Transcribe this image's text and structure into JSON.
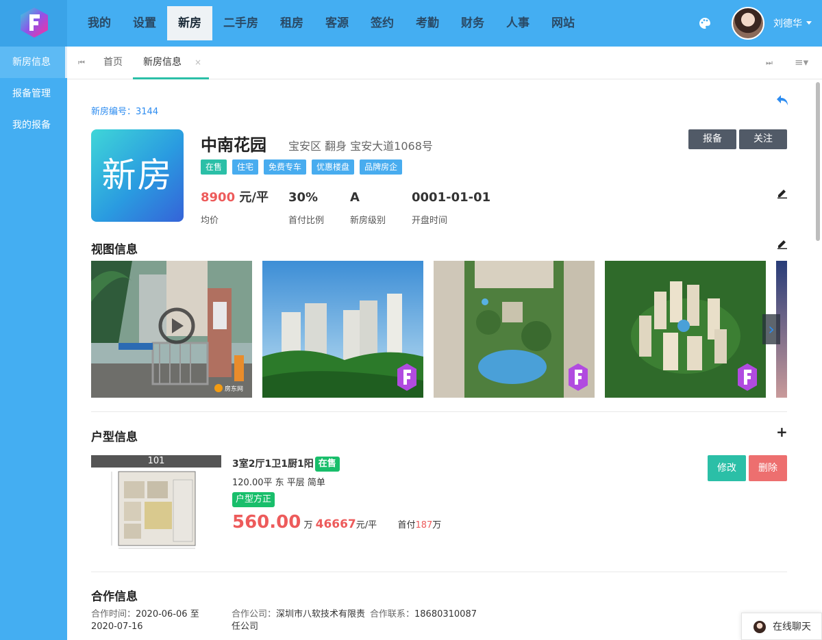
{
  "nav": {
    "items": [
      "我的",
      "设置",
      "新房",
      "二手房",
      "租房",
      "客源",
      "签约",
      "考勤",
      "财务",
      "人事",
      "网站"
    ],
    "active": "新房"
  },
  "user": {
    "name": "刘德华"
  },
  "sidebar": {
    "items": [
      "新房信息",
      "报备管理",
      "我的报备"
    ]
  },
  "tabs": {
    "home": "首页",
    "current": "新房信息",
    "close": "×"
  },
  "house": {
    "number_label": "新房编号：3144",
    "cover_text": "新房",
    "name": "中南花园",
    "address": "宝安区 翻身 宝安大道1068号",
    "tags": [
      "在售",
      "住宅",
      "免费专车",
      "优惠楼盘",
      "品牌房企"
    ],
    "price_value": "8900",
    "price_unit": " 元/平",
    "price_label": "均价",
    "down_ratio": "30%",
    "down_ratio_label": "首付比例",
    "level": "A",
    "level_label": "新房级别",
    "open_date": "0001-01-01",
    "open_date_label": "开盘时间"
  },
  "actions": {
    "report": "报备",
    "follow": "关注"
  },
  "sections": {
    "view": "视图信息",
    "unit": "户型信息",
    "coop": "合作信息"
  },
  "unit": {
    "plan_label": "101",
    "spec": "3室2厅1卫1厨1阳",
    "status": "在售",
    "sub": "120.00平 东 平层 简单",
    "tag": "户型方正",
    "total_price": "560.00",
    "total_unit": " 万 ",
    "unit_price": "46667",
    "unit_price_suffix": "元/平",
    "down_label": "首付",
    "down_value": "187",
    "down_unit": "万",
    "edit": "修改",
    "delete": "删除"
  },
  "coop": {
    "time_label": "合作时间：",
    "time_value": "2020-06-06 至 2020-07-16",
    "company_label": "合作公司：",
    "company_value": "深圳市八软技术有限责任公司",
    "contact_label": "合作联系：",
    "contact_value": "18680310087"
  },
  "chat": {
    "label": "在线聊天"
  },
  "watermark": "房东网"
}
